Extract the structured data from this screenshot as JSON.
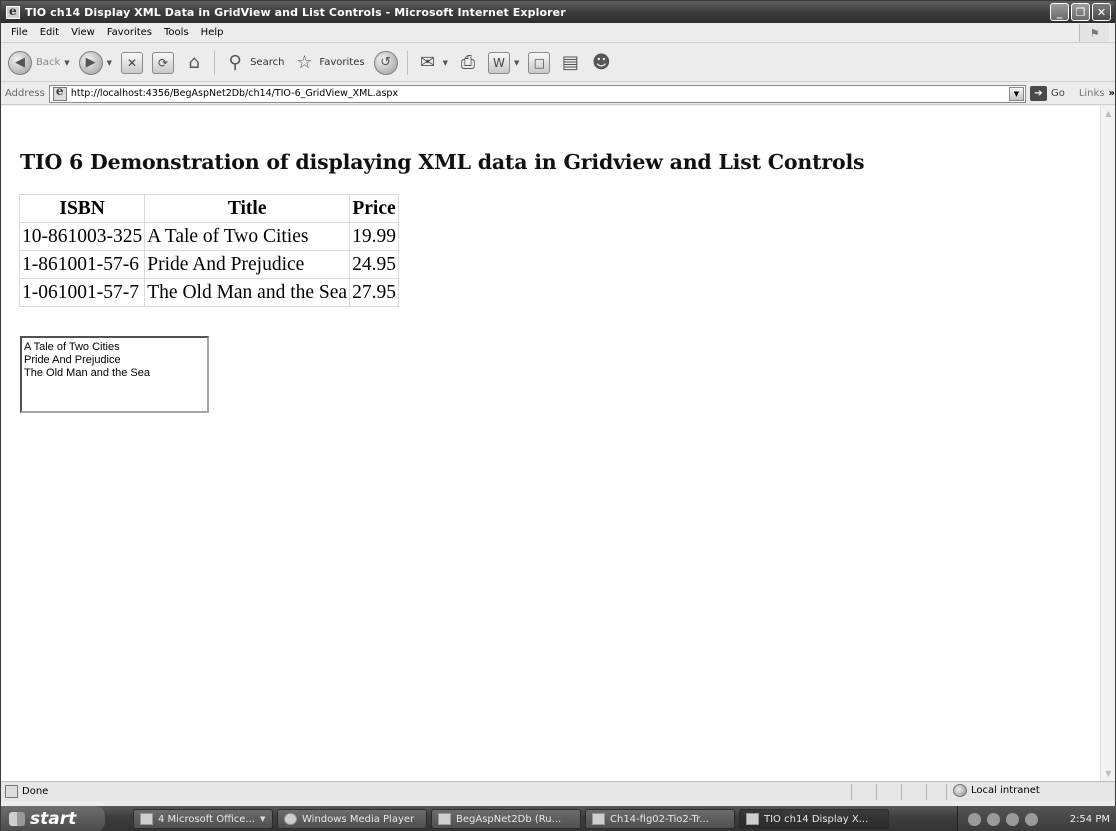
{
  "window": {
    "title": "TIO ch14 Display XML Data in GridView and List Controls - Microsoft Internet Explorer",
    "controls": [
      "_",
      "❐",
      "✕"
    ]
  },
  "menu": [
    "File",
    "Edit",
    "View",
    "Favorites",
    "Tools",
    "Help"
  ],
  "toolbar": {
    "back_label": "Back",
    "search_label": "Search",
    "favorites_label": "Favorites"
  },
  "address": {
    "label": "Address",
    "url": "http://localhost:4356/BegAspNet2Db/ch14/TIO-6_GridView_XML.aspx",
    "go_label": "Go",
    "links_label": "Links"
  },
  "page": {
    "heading": "TIO 6 Demonstration of displaying XML data in Gridview and List Controls",
    "grid": {
      "columns": [
        "ISBN",
        "Title",
        "Price"
      ],
      "rows": [
        [
          "10-861003-325",
          "A Tale of Two Cities",
          "19.99"
        ],
        [
          "1-861001-57-6",
          "Pride And Prejudice",
          "24.95"
        ],
        [
          "1-061001-57-7",
          "The Old Man and the Sea",
          "27.95"
        ]
      ]
    },
    "listbox_items": [
      "A Tale of Two Cities",
      "Pride And Prejudice",
      "The Old Man and the Sea"
    ]
  },
  "status": {
    "text": "Done",
    "zone": "Local intranet"
  },
  "taskbar": {
    "start_label": "start",
    "tasks": [
      {
        "label": "4 Microsoft Office...",
        "active": false
      },
      {
        "label": "Windows Media Player",
        "active": false
      },
      {
        "label": "BegAspNet2Db (Ru...",
        "active": false
      },
      {
        "label": "Ch14-fig02-Tio2-Tr...",
        "active": false
      },
      {
        "label": "TIO ch14 Display X...",
        "active": true
      }
    ],
    "clock": "2:54 PM"
  }
}
